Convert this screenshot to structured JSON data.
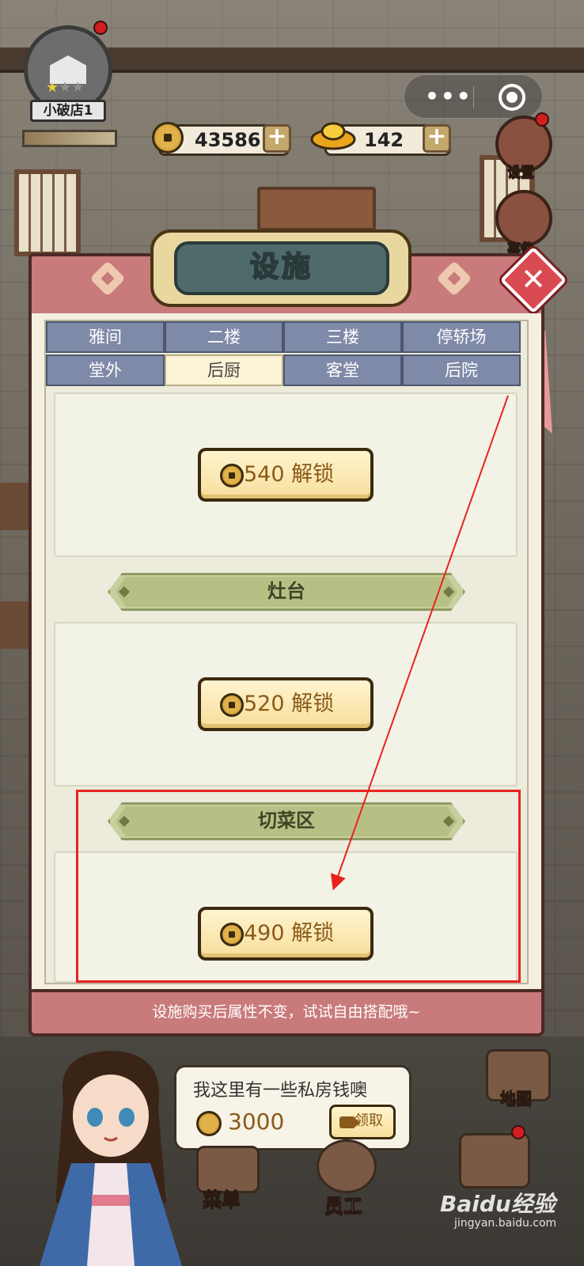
{
  "hud": {
    "shop_name": "小破店1",
    "coins": "43586",
    "ingots": "142",
    "plus_symbol": "+",
    "settings_label": "设置",
    "events_label": "事件"
  },
  "panel": {
    "title": "设施",
    "close_symbol": "✕",
    "tabs_row1": [
      "雅间",
      "二楼",
      "三楼",
      "停轿场"
    ],
    "tabs_row2": [
      "堂外",
      "后厨",
      "客堂",
      "后院"
    ],
    "active_tab": "后厨",
    "sections": [
      {
        "header": "",
        "unlock_label": "540 解锁"
      },
      {
        "header": "灶台",
        "unlock_label": "520 解锁"
      },
      {
        "header": "切菜区",
        "unlock_label": "490 解锁"
      }
    ],
    "footer_text": "设施购买后属性不变，试试自由搭配哦~"
  },
  "npc": {
    "bubble_text": "我这里有一些私房钱噢",
    "reward_amount": "3000",
    "claim_label": "领取"
  },
  "dock": {
    "menu_label": "菜单",
    "staff_label": "员工",
    "map_label": "地图"
  },
  "watermark": {
    "logo": "Baidu经验",
    "url": "jingyan.baidu.com"
  },
  "colors": {
    "annotation": "#e8231d",
    "tab_inactive": "#7f89a8",
    "tab_active": "#fbf4d6",
    "panel_roof": "#c97a7a"
  }
}
